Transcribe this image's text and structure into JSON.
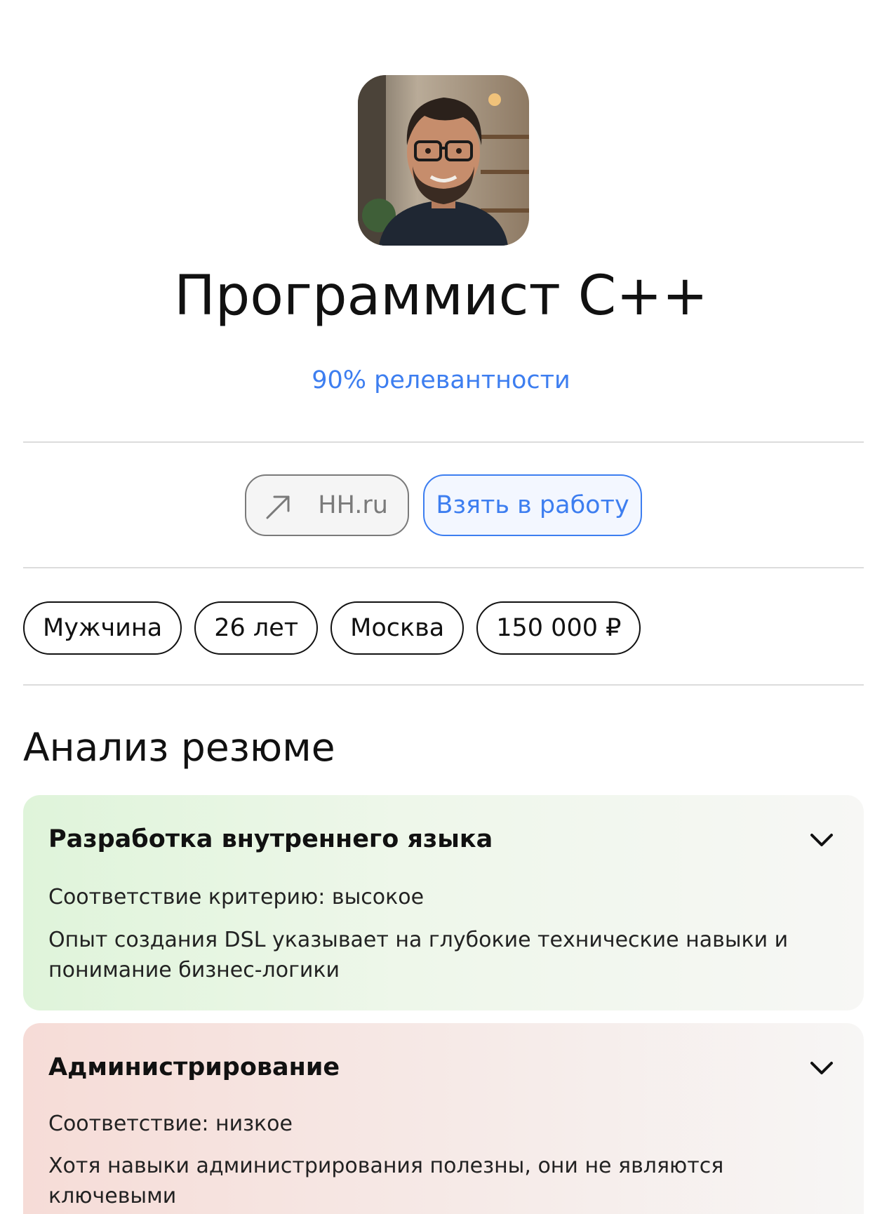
{
  "profile": {
    "title": "Программист C++",
    "relevance": "90% релевантности"
  },
  "actions": {
    "hh_label": "HH.ru",
    "hh_icon": "arrow-up-right-icon",
    "take_label": "Взять в работу"
  },
  "chips": [
    "Мужчина",
    "26 лет",
    "Москва",
    "150 000 ₽"
  ],
  "analysis": {
    "heading": "Анализ резюме",
    "cards": [
      {
        "title": "Разработка внутреннего языка",
        "match": "Соответствие критерию: высокое",
        "comment": "Опыт создания DSL указывает на глубокие технические навыки и понимание бизнес-логики",
        "accent": "#dff4da"
      },
      {
        "title": "Администрирование",
        "match": "Соответствие: низкое",
        "comment": "Хотя навыки администрирования полезны, они не являются ключевыми",
        "accent": "#f6dcd7"
      }
    ]
  },
  "colors": {
    "link_blue": "#3d7ef0",
    "divider": "#dcdcdc"
  }
}
